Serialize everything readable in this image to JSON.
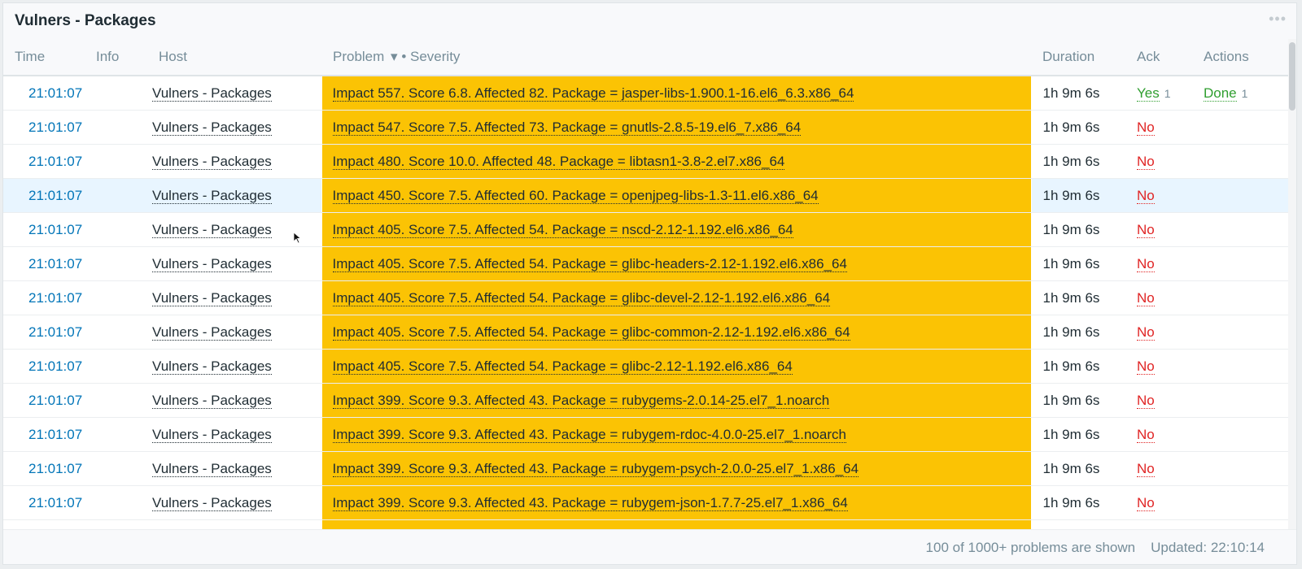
{
  "widget": {
    "title": "Vulners - Packages"
  },
  "columns": {
    "time": "Time",
    "info": "Info",
    "host": "Host",
    "problem": "Problem",
    "sort_icon": "▾",
    "severity": "• Severity",
    "duration": "Duration",
    "ack": "Ack",
    "actions": "Actions"
  },
  "rows": [
    {
      "time": "21:01:07",
      "host": "Vulners - Packages",
      "problem": "Impact 557. Score 6.8. Affected 82. Package = jasper-libs-1.900.1-16.el6_6.3.x86_64",
      "duration": "1h 9m 6s",
      "ack": "Yes",
      "ack_count": "1",
      "action": "Done",
      "action_count": "1"
    },
    {
      "time": "21:01:07",
      "host": "Vulners - Packages",
      "problem": "Impact 547. Score 7.5. Affected 73. Package = gnutls-2.8.5-19.el6_7.x86_64",
      "duration": "1h 9m 6s",
      "ack": "No"
    },
    {
      "time": "21:01:07",
      "host": "Vulners - Packages",
      "problem": "Impact 480. Score 10.0. Affected 48. Package = libtasn1-3.8-2.el7.x86_64",
      "duration": "1h 9m 6s",
      "ack": "No"
    },
    {
      "time": "21:01:07",
      "host": "Vulners - Packages",
      "problem": "Impact 450. Score 7.5. Affected 60. Package = openjpeg-libs-1.3-11.el6.x86_64",
      "duration": "1h 9m 6s",
      "ack": "No"
    },
    {
      "time": "21:01:07",
      "host": "Vulners - Packages",
      "problem": "Impact 405. Score 7.5. Affected 54. Package = nscd-2.12-1.192.el6.x86_64",
      "duration": "1h 9m 6s",
      "ack": "No"
    },
    {
      "time": "21:01:07",
      "host": "Vulners - Packages",
      "problem": "Impact 405. Score 7.5. Affected 54. Package = glibc-headers-2.12-1.192.el6.x86_64",
      "duration": "1h 9m 6s",
      "ack": "No"
    },
    {
      "time": "21:01:07",
      "host": "Vulners - Packages",
      "problem": "Impact 405. Score 7.5. Affected 54. Package = glibc-devel-2.12-1.192.el6.x86_64",
      "duration": "1h 9m 6s",
      "ack": "No"
    },
    {
      "time": "21:01:07",
      "host": "Vulners - Packages",
      "problem": "Impact 405. Score 7.5. Affected 54. Package = glibc-common-2.12-1.192.el6.x86_64",
      "duration": "1h 9m 6s",
      "ack": "No"
    },
    {
      "time": "21:01:07",
      "host": "Vulners - Packages",
      "problem": "Impact 405. Score 7.5. Affected 54. Package = glibc-2.12-1.192.el6.x86_64",
      "duration": "1h 9m 6s",
      "ack": "No"
    },
    {
      "time": "21:01:07",
      "host": "Vulners - Packages",
      "problem": "Impact 399. Score 9.3. Affected 43. Package = rubygems-2.0.14-25.el7_1.noarch",
      "duration": "1h 9m 6s",
      "ack": "No"
    },
    {
      "time": "21:01:07",
      "host": "Vulners - Packages",
      "problem": "Impact 399. Score 9.3. Affected 43. Package = rubygem-rdoc-4.0.0-25.el7_1.noarch",
      "duration": "1h 9m 6s",
      "ack": "No"
    },
    {
      "time": "21:01:07",
      "host": "Vulners - Packages",
      "problem": "Impact 399. Score 9.3. Affected 43. Package = rubygem-psych-2.0.0-25.el7_1.x86_64",
      "duration": "1h 9m 6s",
      "ack": "No"
    },
    {
      "time": "21:01:07",
      "host": "Vulners - Packages",
      "problem": "Impact 399. Score 9.3. Affected 43. Package = rubygem-json-1.7.7-25.el7_1.x86_64",
      "duration": "1h 9m 6s",
      "ack": "No"
    },
    {
      "time": "",
      "host": "",
      "problem": "",
      "duration": "",
      "ack": ""
    }
  ],
  "footer": {
    "shown": "100 of 1000+ problems are shown",
    "updated": "Updated: 22:10:14"
  },
  "colors": {
    "severity_average": "#fbc304",
    "link": "#0275b8",
    "ack_no": "#e02424",
    "ack_yes": "#2f9e2f",
    "hover_row": "#e8f5ff"
  }
}
